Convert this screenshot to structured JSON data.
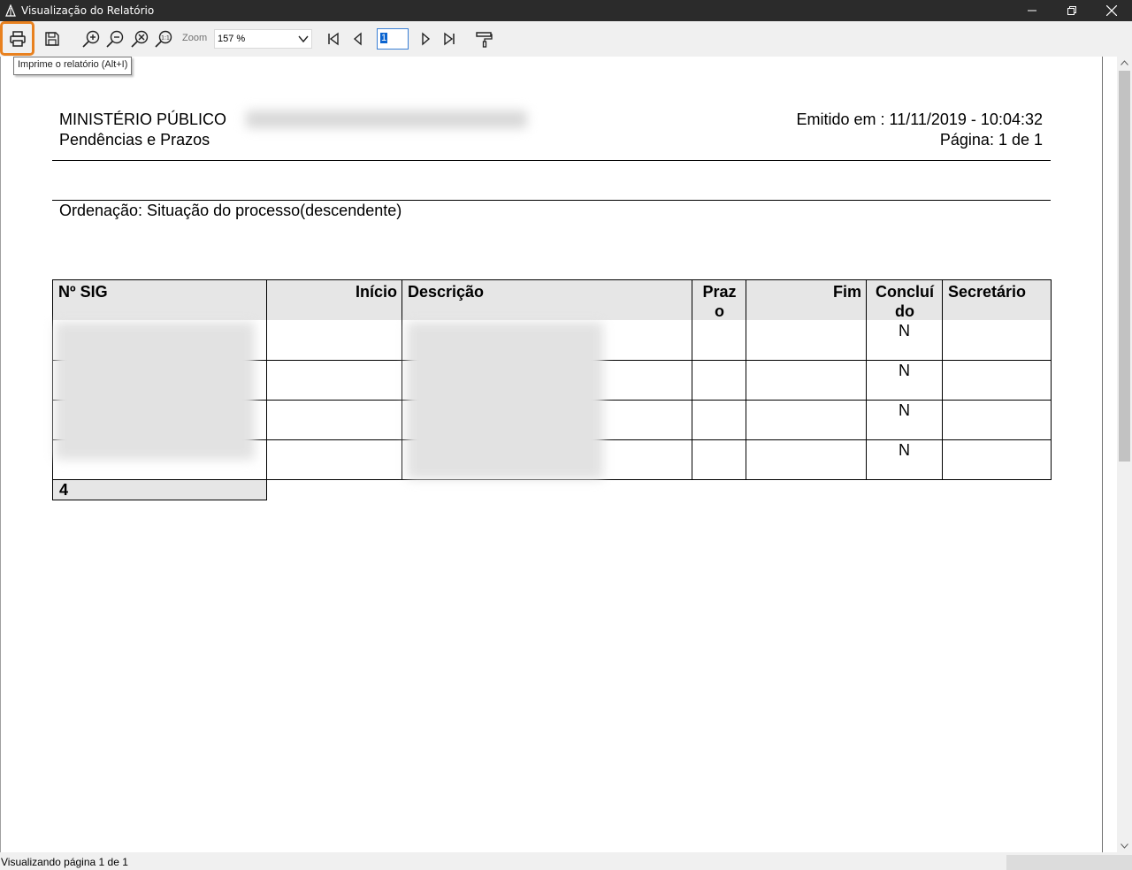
{
  "window": {
    "title": "Visualização do Relatório"
  },
  "toolbar": {
    "print_tooltip": "Imprime o relatório (Alt+I)",
    "zoom_label": "Zoom",
    "zoom_value": "157 %",
    "page_value": "1",
    "highlight_color": "#e8811f"
  },
  "report": {
    "org": "MINISTÉRIO PÚBLICO",
    "subtitle": "Pendências e Prazos",
    "issued": "Emitido em : 11/11/2019 - 10:04:32",
    "page": "Página: 1 de 1",
    "ordering": "Ordenação: Situação do processo(descendente)",
    "columns": [
      {
        "label": "Nº SIG"
      },
      {
        "label": "Início"
      },
      {
        "label": "Descrição"
      },
      {
        "label": "Praz o"
      },
      {
        "label": "Fim"
      },
      {
        "label": "Concluí do"
      },
      {
        "label": "Secretário"
      }
    ],
    "rows": [
      {
        "concluido": "N"
      },
      {
        "concluido": "N"
      },
      {
        "concluido": "N"
      },
      {
        "concluido": "N"
      }
    ],
    "total": "4"
  },
  "status": {
    "text": "Visualizando página 1 de 1"
  }
}
